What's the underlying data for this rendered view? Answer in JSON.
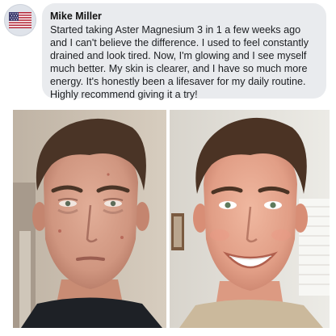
{
  "comment": {
    "author": "Mike Miller",
    "avatar_icon": "us-flag-icon",
    "text": "Started taking Aster Magnesium 3 in 1 a few weeks ago and I can't believe the difference. I used to feel constantly drained and look tired. Now, I'm glowing and I see myself much better. My skin is clearer, and I have so much more energy. It's honestly been a lifesaver for my daily routine. Highly recommend giving it a try!"
  },
  "photos": {
    "before": {
      "subject": "before-photo",
      "expression": "neutral"
    },
    "after": {
      "subject": "after-photo",
      "expression": "smiling"
    }
  },
  "colors": {
    "bubble": "#e9ebee",
    "name": "#111111",
    "text": "#1c1e21"
  }
}
